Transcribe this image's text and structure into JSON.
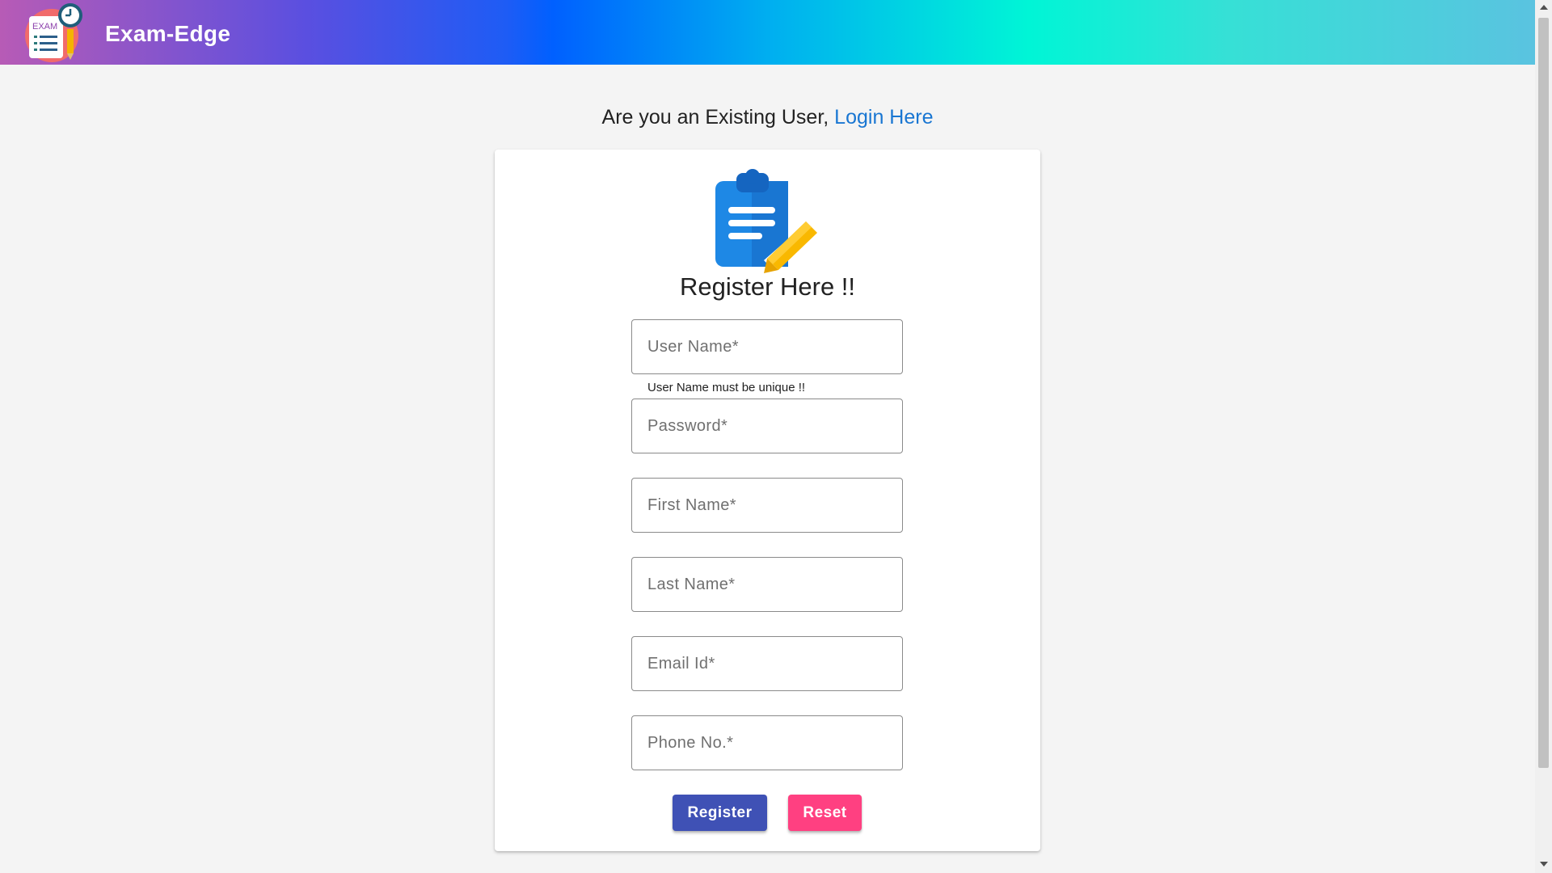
{
  "navbar": {
    "brand": "Exam-Edge",
    "logo_icon": "exam-logo-icon",
    "logo_text": "EXAM"
  },
  "existing_user": {
    "prompt": "Are you an Existing User,",
    "login_link": "Login Here"
  },
  "form": {
    "icon": "clipboard-pencil-icon",
    "title": "Register Here !!",
    "username_placeholder": "User Name*",
    "username_hint": "User Name must be unique !!",
    "password_placeholder": "Password*",
    "firstname_placeholder": "First Name*",
    "lastname_placeholder": "Last Name*",
    "email_placeholder": "Email Id*",
    "phone_placeholder": "Phone No.*",
    "register_label": "Register",
    "reset_label": "Reset"
  },
  "colors": {
    "primary": "#3f51b5",
    "accent": "#ff4081",
    "link": "#1976d2"
  }
}
